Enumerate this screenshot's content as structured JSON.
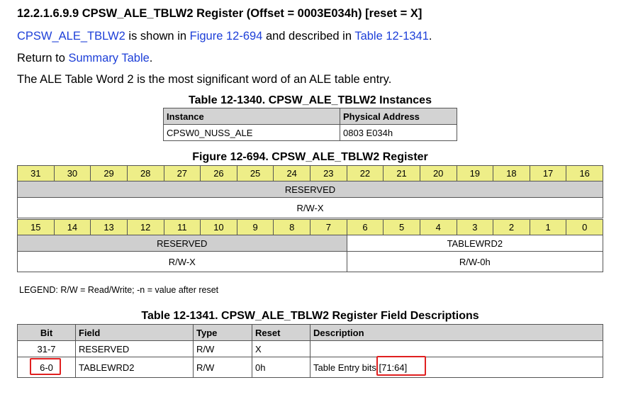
{
  "section_heading": "12.2.1.6.9.9 CPSW_ALE_TBLW2 Register (Offset = 0003E034h) [reset = X]",
  "intro": {
    "reg_link": "CPSW_ALE_TBLW2",
    "is_shown_in": " is shown in ",
    "figure_link": "Figure 12-694",
    "described_in": " and described in ",
    "table_link": "Table 12-1341",
    "period": "."
  },
  "return_line": {
    "prefix": "Return to ",
    "link": "Summary Table",
    "suffix": "."
  },
  "description_para": "The ALE Table Word 2 is the most significant word of an ALE table entry.",
  "instances_table": {
    "caption": "Table 12-1340. CPSW_ALE_TBLW2 Instances",
    "headers": [
      "Instance",
      "Physical Address"
    ],
    "rows": [
      [
        "CPSW0_NUSS_ALE",
        "0803 E034h"
      ]
    ]
  },
  "register_figure": {
    "caption": "Figure 12-694. CPSW_ALE_TBLW2 Register",
    "upper_bits": [
      "31",
      "30",
      "29",
      "28",
      "27",
      "26",
      "25",
      "24",
      "23",
      "22",
      "21",
      "20",
      "19",
      "18",
      "17",
      "16"
    ],
    "upper_field": "RESERVED",
    "upper_access": "R/W-X",
    "lower_bits": [
      "15",
      "14",
      "13",
      "12",
      "11",
      "10",
      "9",
      "8",
      "7",
      "6",
      "5",
      "4",
      "3",
      "2",
      "1",
      "0"
    ],
    "lower_fields": [
      "RESERVED",
      "TABLEWRD2"
    ],
    "lower_access": [
      "R/W-X",
      "R/W-0h"
    ]
  },
  "legend": "LEGEND: R/W = Read/Write; -n = value after reset",
  "field_table": {
    "caption": "Table 12-1341. CPSW_ALE_TBLW2 Register Field Descriptions",
    "headers": [
      "Bit",
      "Field",
      "Type",
      "Reset",
      "Description"
    ],
    "rows": [
      [
        "31-7",
        "RESERVED",
        "R/W",
        "X",
        ""
      ],
      [
        "6-0",
        "TABLEWRD2",
        "R/W",
        "0h",
        "Table Entry bits [71:64]"
      ]
    ]
  },
  "annotation_color": "#e02020",
  "link_color": "#1d3fd8",
  "bit_row_color": "#eeee88",
  "header_color": "#d3d3d3"
}
